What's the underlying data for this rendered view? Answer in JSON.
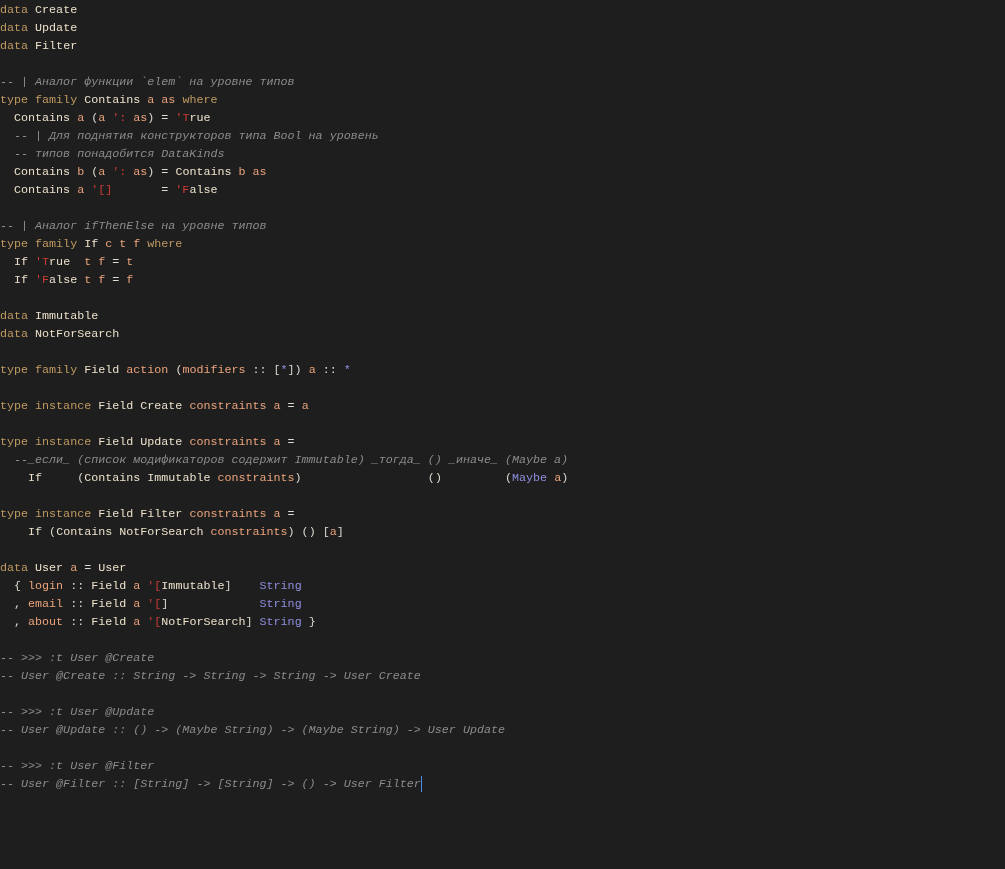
{
  "lines": [
    {
      "kind": "code",
      "tokens": [
        {
          "kind": "kw",
          "text": "data "
        },
        {
          "kind": "con",
          "text": "Create"
        }
      ]
    },
    {
      "kind": "code",
      "tokens": [
        {
          "kind": "kw",
          "text": "data "
        },
        {
          "kind": "con",
          "text": "Update"
        }
      ]
    },
    {
      "kind": "code",
      "tokens": [
        {
          "kind": "kw",
          "text": "data "
        },
        {
          "kind": "con",
          "text": "Filter"
        }
      ]
    },
    {
      "kind": "blank"
    },
    {
      "kind": "code",
      "tokens": [
        {
          "kind": "comment",
          "text": "-- | Аналог функции `elem` на уровне типов"
        }
      ]
    },
    {
      "kind": "code",
      "tokens": [
        {
          "kind": "kw",
          "text": "type family "
        },
        {
          "kind": "con",
          "text": "Contains "
        },
        {
          "kind": "var",
          "text": "a as "
        },
        {
          "kind": "kw",
          "text": "where"
        }
      ]
    },
    {
      "kind": "code",
      "tokens": [
        {
          "kind": "con",
          "text": "  Contains "
        },
        {
          "kind": "var",
          "text": "a "
        },
        {
          "kind": "op",
          "text": "("
        },
        {
          "kind": "var",
          "text": "a "
        },
        {
          "kind": "tick",
          "text": "':"
        },
        {
          "kind": "var",
          "text": " as"
        },
        {
          "kind": "op",
          "text": ") = "
        },
        {
          "kind": "tick",
          "text": "'T"
        },
        {
          "kind": "con",
          "text": "rue"
        }
      ]
    },
    {
      "kind": "code",
      "tokens": [
        {
          "kind": "comment",
          "text": "  -- | Для поднятия конструкторов типа Bool на уровень"
        }
      ]
    },
    {
      "kind": "code",
      "tokens": [
        {
          "kind": "comment",
          "text": "  -- типов понадобится DataKinds"
        }
      ]
    },
    {
      "kind": "code",
      "tokens": [
        {
          "kind": "con",
          "text": "  Contains "
        },
        {
          "kind": "var",
          "text": "b "
        },
        {
          "kind": "op",
          "text": "("
        },
        {
          "kind": "var",
          "text": "a "
        },
        {
          "kind": "tick",
          "text": "':"
        },
        {
          "kind": "var",
          "text": " as"
        },
        {
          "kind": "op",
          "text": ") = "
        },
        {
          "kind": "con",
          "text": "Contains "
        },
        {
          "kind": "var",
          "text": "b as"
        }
      ]
    },
    {
      "kind": "code",
      "tokens": [
        {
          "kind": "con",
          "text": "  Contains "
        },
        {
          "kind": "var",
          "text": "a "
        },
        {
          "kind": "tick",
          "text": "'[]"
        },
        {
          "kind": "op",
          "text": "       = "
        },
        {
          "kind": "tick",
          "text": "'F"
        },
        {
          "kind": "con",
          "text": "alse"
        }
      ]
    },
    {
      "kind": "blank"
    },
    {
      "kind": "code",
      "tokens": [
        {
          "kind": "comment",
          "text": "-- | Аналог ifThenElse на уровне типов"
        }
      ]
    },
    {
      "kind": "code",
      "tokens": [
        {
          "kind": "kw",
          "text": "type family "
        },
        {
          "kind": "con",
          "text": "If "
        },
        {
          "kind": "var",
          "text": "c t f "
        },
        {
          "kind": "kw",
          "text": "where"
        }
      ]
    },
    {
      "kind": "code",
      "tokens": [
        {
          "kind": "con",
          "text": "  If "
        },
        {
          "kind": "tick",
          "text": "'T"
        },
        {
          "kind": "con",
          "text": "rue  "
        },
        {
          "kind": "var",
          "text": "t f "
        },
        {
          "kind": "op",
          "text": "= "
        },
        {
          "kind": "var",
          "text": "t"
        }
      ]
    },
    {
      "kind": "code",
      "tokens": [
        {
          "kind": "con",
          "text": "  If "
        },
        {
          "kind": "tick",
          "text": "'F"
        },
        {
          "kind": "con",
          "text": "alse "
        },
        {
          "kind": "var",
          "text": "t f "
        },
        {
          "kind": "op",
          "text": "= "
        },
        {
          "kind": "var",
          "text": "f"
        }
      ]
    },
    {
      "kind": "blank"
    },
    {
      "kind": "code",
      "tokens": [
        {
          "kind": "kw",
          "text": "data "
        },
        {
          "kind": "con",
          "text": "Immutable"
        }
      ]
    },
    {
      "kind": "code",
      "tokens": [
        {
          "kind": "kw",
          "text": "data "
        },
        {
          "kind": "con",
          "text": "NotForSearch"
        }
      ]
    },
    {
      "kind": "blank"
    },
    {
      "kind": "code",
      "tokens": [
        {
          "kind": "kw",
          "text": "type family "
        },
        {
          "kind": "con",
          "text": "Field "
        },
        {
          "kind": "var",
          "text": "action "
        },
        {
          "kind": "op",
          "text": "("
        },
        {
          "kind": "var",
          "text": "modifiers "
        },
        {
          "kind": "op",
          "text": ":: ["
        },
        {
          "kind": "builtin",
          "text": "*"
        },
        {
          "kind": "op",
          "text": "]) "
        },
        {
          "kind": "var",
          "text": "a "
        },
        {
          "kind": "op",
          "text": ":: "
        },
        {
          "kind": "builtin",
          "text": "*"
        }
      ]
    },
    {
      "kind": "blank"
    },
    {
      "kind": "code",
      "tokens": [
        {
          "kind": "kw",
          "text": "type instance "
        },
        {
          "kind": "con",
          "text": "Field Create "
        },
        {
          "kind": "var",
          "text": "constraints a "
        },
        {
          "kind": "op",
          "text": "= "
        },
        {
          "kind": "var",
          "text": "a"
        }
      ]
    },
    {
      "kind": "blank"
    },
    {
      "kind": "code",
      "tokens": [
        {
          "kind": "kw",
          "text": "type instance "
        },
        {
          "kind": "con",
          "text": "Field Update "
        },
        {
          "kind": "var",
          "text": "constraints a "
        },
        {
          "kind": "op",
          "text": "="
        }
      ]
    },
    {
      "kind": "code",
      "tokens": [
        {
          "kind": "comment",
          "text": "  --_если_ (список модификаторов содержит Immutable) _тогда_ () _иначе_ (Maybe a)"
        }
      ]
    },
    {
      "kind": "code",
      "tokens": [
        {
          "kind": "con",
          "text": "    If"
        },
        {
          "kind": "op",
          "text": "     ("
        },
        {
          "kind": "con",
          "text": "Contains Immutable "
        },
        {
          "kind": "var",
          "text": "constraints"
        },
        {
          "kind": "op",
          "text": ")                  ()         ("
        },
        {
          "kind": "builtin",
          "text": "Maybe"
        },
        {
          "kind": "var",
          "text": " a"
        },
        {
          "kind": "op",
          "text": ")"
        }
      ]
    },
    {
      "kind": "blank"
    },
    {
      "kind": "code",
      "tokens": [
        {
          "kind": "kw",
          "text": "type instance "
        },
        {
          "kind": "con",
          "text": "Field Filter "
        },
        {
          "kind": "var",
          "text": "constraints a "
        },
        {
          "kind": "op",
          "text": "="
        }
      ]
    },
    {
      "kind": "code",
      "tokens": [
        {
          "kind": "con",
          "text": "    If "
        },
        {
          "kind": "op",
          "text": "("
        },
        {
          "kind": "con",
          "text": "Contains NotForSearch "
        },
        {
          "kind": "var",
          "text": "constraints"
        },
        {
          "kind": "op",
          "text": ") () ["
        },
        {
          "kind": "var",
          "text": "a"
        },
        {
          "kind": "op",
          "text": "]"
        }
      ]
    },
    {
      "kind": "blank"
    },
    {
      "kind": "code",
      "tokens": [
        {
          "kind": "kw",
          "text": "data "
        },
        {
          "kind": "con",
          "text": "User "
        },
        {
          "kind": "var",
          "text": "a "
        },
        {
          "kind": "op",
          "text": "= "
        },
        {
          "kind": "con",
          "text": "User"
        }
      ]
    },
    {
      "kind": "code",
      "tokens": [
        {
          "kind": "op",
          "text": "  { "
        },
        {
          "kind": "var",
          "text": "login "
        },
        {
          "kind": "op",
          "text": ":: "
        },
        {
          "kind": "con",
          "text": "Field "
        },
        {
          "kind": "var",
          "text": "a "
        },
        {
          "kind": "tick",
          "text": "'["
        },
        {
          "kind": "con",
          "text": "Immutable"
        },
        {
          "kind": "op",
          "text": "]    "
        },
        {
          "kind": "builtin",
          "text": "String"
        }
      ]
    },
    {
      "kind": "code",
      "tokens": [
        {
          "kind": "op",
          "text": "  , "
        },
        {
          "kind": "var",
          "text": "email "
        },
        {
          "kind": "op",
          "text": ":: "
        },
        {
          "kind": "con",
          "text": "Field "
        },
        {
          "kind": "var",
          "text": "a "
        },
        {
          "kind": "tick",
          "text": "'["
        },
        {
          "kind": "op",
          "text": "]             "
        },
        {
          "kind": "builtin",
          "text": "String"
        }
      ]
    },
    {
      "kind": "code",
      "tokens": [
        {
          "kind": "op",
          "text": "  , "
        },
        {
          "kind": "var",
          "text": "about "
        },
        {
          "kind": "op",
          "text": ":: "
        },
        {
          "kind": "con",
          "text": "Field "
        },
        {
          "kind": "var",
          "text": "a "
        },
        {
          "kind": "tick",
          "text": "'["
        },
        {
          "kind": "con",
          "text": "NotForSearch"
        },
        {
          "kind": "op",
          "text": "] "
        },
        {
          "kind": "builtin",
          "text": "String"
        },
        {
          "kind": "op",
          "text": " }"
        }
      ]
    },
    {
      "kind": "blank"
    },
    {
      "kind": "code",
      "tokens": [
        {
          "kind": "comment",
          "text": "-- >>> :t User @Create"
        }
      ]
    },
    {
      "kind": "code",
      "tokens": [
        {
          "kind": "comment",
          "text": "-- User @Create :: String -> String -> String -> User Create"
        }
      ]
    },
    {
      "kind": "blank"
    },
    {
      "kind": "code",
      "tokens": [
        {
          "kind": "comment",
          "text": "-- >>> :t User @Update"
        }
      ]
    },
    {
      "kind": "code",
      "tokens": [
        {
          "kind": "comment",
          "text": "-- User @Update :: () -> (Maybe String) -> (Maybe String) -> User Update"
        }
      ]
    },
    {
      "kind": "blank"
    },
    {
      "kind": "code",
      "tokens": [
        {
          "kind": "comment",
          "text": "-- >>> :t User @Filter"
        }
      ]
    },
    {
      "kind": "code",
      "cursor": true,
      "tokens": [
        {
          "kind": "comment",
          "text": "-- User @Filter :: [String] -> [String] -> () -> User Filter"
        }
      ]
    }
  ]
}
